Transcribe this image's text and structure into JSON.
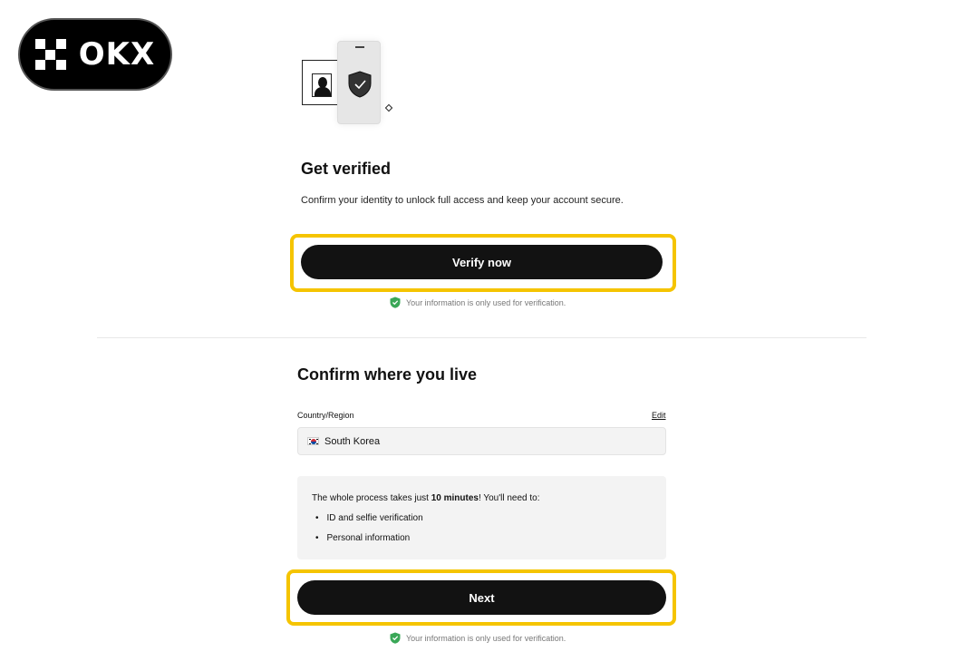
{
  "logo": {
    "text": "OKX"
  },
  "verify_section": {
    "title": "Get verified",
    "subtitle": "Confirm your identity to unlock full access and keep your account secure.",
    "button_label": "Verify now",
    "note": "Your information is only used for verification."
  },
  "residence_section": {
    "title": "Confirm where you live",
    "field_label": "Country/Region",
    "edit_label": "Edit",
    "country_value": "South Korea",
    "info": {
      "prefix": "The whole process takes just ",
      "duration": "10 minutes",
      "suffix": "! You'll need to:",
      "items": [
        "ID and selfie verification",
        "Personal information"
      ]
    },
    "button_label": "Next",
    "note": "Your information is only used for verification."
  },
  "colors": {
    "highlight": "#f5c400",
    "button_bg": "#121212",
    "shield_green": "#3aa757"
  },
  "icons": [
    "okx-logo-icon",
    "id-card-icon",
    "shield-check-icon",
    "check-shield-icon",
    "korea-flag-icon"
  ]
}
